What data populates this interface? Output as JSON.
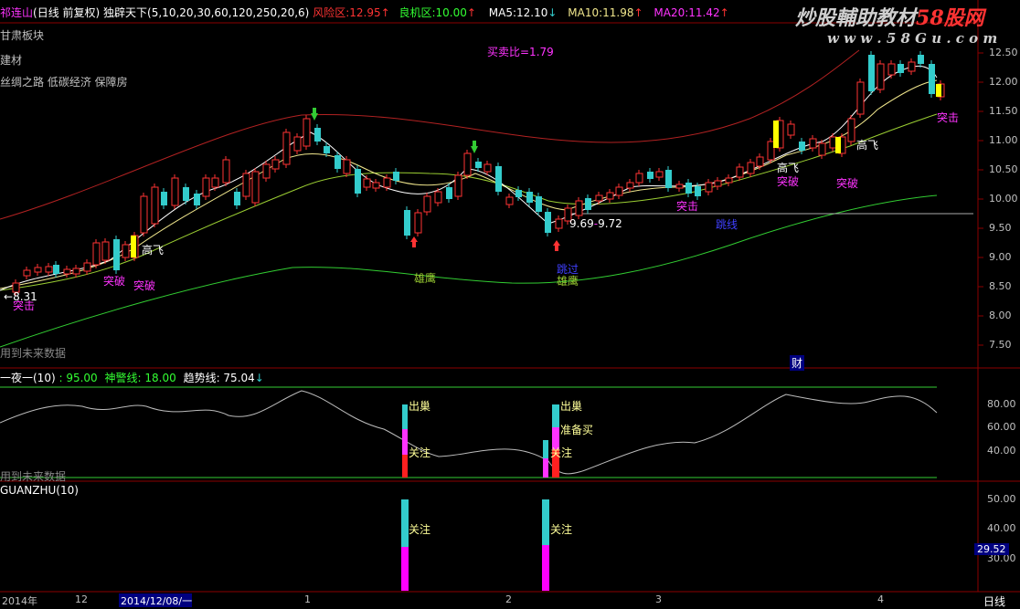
{
  "colors": {
    "bg": "#000000",
    "frame": "#8b0000",
    "up": "#ff3333",
    "down": "#33cccc",
    "ma5": "#ffffff",
    "ma10": "#f0e68c",
    "ma20": "#9acd32",
    "upper_band": "#b22222",
    "lower_band": "#32cd32",
    "magenta": "#ff33ff",
    "yellow": "#ffff00",
    "green": "#33ff33"
  },
  "header": {
    "stock_name": "祁连山",
    "period": "(日线 前复权)",
    "indicator": "独辟天下",
    "params": "(5,10,20,30,60,120,250,20,6)",
    "risk_label": "风险区:",
    "risk_value": "12.95",
    "opportunity_label": "良机区:",
    "opportunity_value": "10.00",
    "ma5_label": "MA5:",
    "ma5_value": "12.10",
    "ma10_label": "MA10:",
    "ma10_value": "11.98",
    "ma20_label": "MA20:",
    "ma20_value": "11.42"
  },
  "watermark": {
    "title": "炒股輔助教材",
    "brand": "58股网",
    "url": "w w w . 5 8 G u . c o m"
  },
  "main_panel": {
    "sector_label": "甘肃板块",
    "industry_label": "建材",
    "concepts_label": "丝绸之路 低碳经济 保障房",
    "buy_sell_ratio": "买卖比=1.79",
    "future_data_note": "用到未来数据",
    "price_ticks": [
      "12.50",
      "12.00",
      "11.50",
      "11.00",
      "10.50",
      "10.00",
      "9.50",
      "9.00",
      "8.50",
      "8.00",
      "7.50"
    ],
    "annotations": {
      "low_start": "8.31",
      "tuji_1": "突击",
      "tupo_1": "突破",
      "tupo_2": "突破",
      "gaofei_1": "高飞",
      "xiongying_1": "雄鹰",
      "xiongying_2": "雄鹰",
      "tiaoguo": "跳过",
      "low_price_a": "9.69",
      "low_price_b": "9.72",
      "tuji_2": "突击",
      "tiaoguan": "跳线",
      "gaofei_2": "高飞",
      "tupo_3": "突破",
      "gaofei_3": "高飞",
      "tupo_4": "突破",
      "tuji_3": "突击",
      "cai": "财"
    }
  },
  "indicator_panel": {
    "name": "一夜一(10)",
    "value": ": 95.00",
    "shen_label": "神警线: 18.00",
    "trend_label": "趋势线: 75.04",
    "future_data_note": "用到未来数据",
    "ticks": [
      "80.00",
      "60.00",
      "40.00"
    ],
    "signals": {
      "chuchao_1": "出巢",
      "guanzhu_1": "关注",
      "chuchao_2": "出巢",
      "zhunbeimai": "准备买",
      "guanzhu_2": "关注"
    }
  },
  "guanzhu_panel": {
    "name": "GUANZHU(10)",
    "ticks": [
      "50.00",
      "40.00",
      "30.00"
    ],
    "current_value": "29.52",
    "signals": {
      "guanzhu_1": "关注",
      "guanzhu_2": "关注"
    }
  },
  "time_axis": {
    "labels": [
      "2014年",
      "12",
      "2014/12/08/一",
      "1",
      "2",
      "3",
      "4"
    ],
    "period_button": "日线"
  }
}
